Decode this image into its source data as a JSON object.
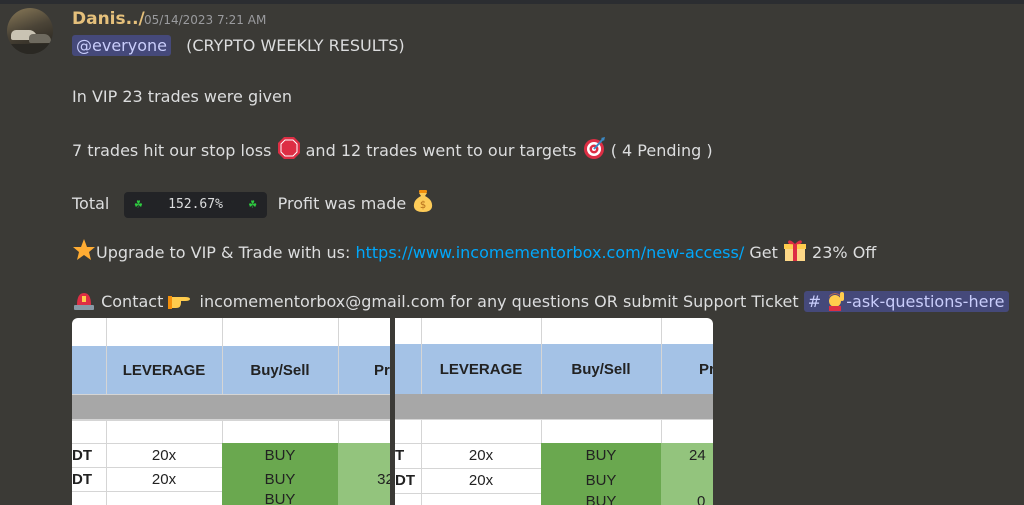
{
  "message": {
    "username": "Danis../",
    "timestamp": "05/14/2023 7:21 AM",
    "mention": "@everyone",
    "title": "(CRYPTO WEEKLY RESULTS)",
    "line_vip": "In VIP 23 trades were given",
    "stop_loss_text": "7 trades hit our stop loss",
    "targets_text": "and 12 trades went to our targets",
    "pending_text": "( 4 Pending )",
    "total_label": "Total",
    "total_value": "152.67%",
    "profit_text": "Profit was made",
    "upgrade_text": "Upgrade to VIP & Trade with us:",
    "link": "https://www.incomementorbox.com/new-access/",
    "get_text": "Get",
    "off_text": "23% Off",
    "contact_text": "Contact",
    "email_text": "incomementorbox@gmail.com for any questions OR submit Support Ticket",
    "channel_hash": "#",
    "channel_name": "-ask-questions-here"
  },
  "icons": {
    "stop": "stop-sign-icon",
    "target": "target-icon",
    "clover": "four-leaf-clover-icon",
    "money": "money-bag-icon",
    "star": "star-icon",
    "gift": "gift-icon",
    "alarm": "siren-icon",
    "pointing": "pointing-hand-icon",
    "raise_hand": "raising-hand-icon"
  },
  "sheet1": {
    "headers": [
      "LEVERAGE",
      "Buy/Sell",
      "Pr"
    ],
    "rows": [
      {
        "pair": "DT",
        "leverage": "20x",
        "side": "BUY",
        "price": ""
      },
      {
        "pair": "DT",
        "leverage": "20x",
        "side": "BUY",
        "price": "32."
      },
      {
        "pair": "",
        "leverage": "",
        "side": "BUY",
        "price": ""
      }
    ]
  },
  "sheet2": {
    "headers": [
      "LEVERAGE",
      "Buy/Sell",
      "Pr"
    ],
    "rows": [
      {
        "pair": "T",
        "leverage": "20x",
        "side": "BUY",
        "price": "24"
      },
      {
        "pair": "DT",
        "leverage": "20x",
        "side": "BUY",
        "price": ""
      },
      {
        "pair": "",
        "leverage": "",
        "side": "BUY",
        "price": "0"
      }
    ]
  },
  "colors": {
    "background": "#3b3a36",
    "username": "#e5c07b",
    "link": "#00a8fc",
    "mention_bg": "#45497a"
  }
}
